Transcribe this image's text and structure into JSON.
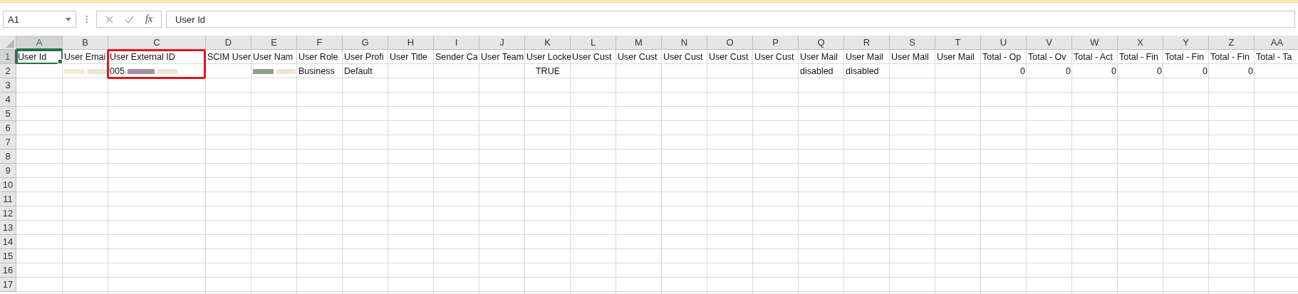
{
  "name_box": {
    "value": "A1"
  },
  "formula_bar": {
    "function_label": "fx",
    "value": "User Id"
  },
  "columns": [
    {
      "letter": "A",
      "selected": true,
      "highlighted": false
    },
    {
      "letter": "B",
      "selected": false,
      "highlighted": false
    },
    {
      "letter": "C",
      "selected": false,
      "highlighted": true
    },
    {
      "letter": "D",
      "selected": false,
      "highlighted": false
    },
    {
      "letter": "E",
      "selected": false,
      "highlighted": false
    },
    {
      "letter": "F",
      "selected": false,
      "highlighted": false
    },
    {
      "letter": "G",
      "selected": false,
      "highlighted": false
    },
    {
      "letter": "H",
      "selected": false,
      "highlighted": false
    },
    {
      "letter": "I",
      "selected": false,
      "highlighted": false
    },
    {
      "letter": "J",
      "selected": false,
      "highlighted": false
    },
    {
      "letter": "K",
      "selected": false,
      "highlighted": false
    },
    {
      "letter": "L",
      "selected": false,
      "highlighted": false
    },
    {
      "letter": "M",
      "selected": false,
      "highlighted": false
    },
    {
      "letter": "N",
      "selected": false,
      "highlighted": false
    },
    {
      "letter": "O",
      "selected": false,
      "highlighted": false
    },
    {
      "letter": "P",
      "selected": false,
      "highlighted": false
    },
    {
      "letter": "Q",
      "selected": false,
      "highlighted": false
    },
    {
      "letter": "R",
      "selected": false,
      "highlighted": false
    },
    {
      "letter": "S",
      "selected": false,
      "highlighted": false
    },
    {
      "letter": "T",
      "selected": false,
      "highlighted": false
    },
    {
      "letter": "U",
      "selected": false,
      "highlighted": false
    },
    {
      "letter": "V",
      "selected": false,
      "highlighted": false
    },
    {
      "letter": "W",
      "selected": false,
      "highlighted": false
    },
    {
      "letter": "X",
      "selected": false,
      "highlighted": false
    },
    {
      "letter": "Y",
      "selected": false,
      "highlighted": false
    },
    {
      "letter": "Z",
      "selected": false,
      "highlighted": false
    },
    {
      "letter": "AA",
      "selected": false,
      "highlighted": false
    }
  ],
  "rows": [
    {
      "number": "1",
      "selected": true,
      "cells": [
        {
          "kind": "text",
          "text": "User Id",
          "selected": true
        },
        {
          "kind": "text",
          "text": "User Emai",
          "selected": false
        },
        {
          "kind": "text",
          "text": "User External ID",
          "selected": false
        },
        {
          "kind": "text",
          "text": "SCIM User",
          "selected": false
        },
        {
          "kind": "text",
          "text": "User Nam",
          "selected": false
        },
        {
          "kind": "text",
          "text": "User Role",
          "selected": false
        },
        {
          "kind": "text",
          "text": "User Profi",
          "selected": false
        },
        {
          "kind": "text",
          "text": "User Title",
          "selected": false
        },
        {
          "kind": "text",
          "text": "Sender Ca",
          "selected": false
        },
        {
          "kind": "text",
          "text": "User Team",
          "selected": false
        },
        {
          "kind": "text",
          "text": "User Locke",
          "selected": false
        },
        {
          "kind": "text",
          "text": "User Cust",
          "selected": false
        },
        {
          "kind": "text",
          "text": "User Cust",
          "selected": false
        },
        {
          "kind": "text",
          "text": "User Cust",
          "selected": false
        },
        {
          "kind": "text",
          "text": "User Cust",
          "selected": false
        },
        {
          "kind": "text",
          "text": "User Cust",
          "selected": false
        },
        {
          "kind": "text",
          "text": "User Mail",
          "selected": false
        },
        {
          "kind": "text",
          "text": "User Mail",
          "selected": false
        },
        {
          "kind": "text",
          "text": "User Mail",
          "selected": false
        },
        {
          "kind": "text",
          "text": "User Mail",
          "selected": false
        },
        {
          "kind": "text",
          "text": "Total - Op",
          "selected": false
        },
        {
          "kind": "text",
          "text": "Total - Ov",
          "selected": false
        },
        {
          "kind": "text",
          "text": "Total - Act",
          "selected": false
        },
        {
          "kind": "text",
          "text": "Total - Fin",
          "selected": false
        },
        {
          "kind": "text",
          "text": "Total - Fin",
          "selected": false
        },
        {
          "kind": "text",
          "text": "Total - Fin",
          "selected": false
        },
        {
          "kind": "text",
          "text": "Total - Ta",
          "selected": false
        }
      ]
    },
    {
      "number": "2",
      "selected": false,
      "cells": [
        {
          "kind": "blank"
        },
        {
          "kind": "redacted",
          "selected": false
        },
        {
          "kind": "redacted",
          "text": "005",
          "selected": false
        },
        {
          "kind": "blank"
        },
        {
          "kind": "redacted",
          "selected": false
        },
        {
          "kind": "text",
          "text": "Business",
          "selected": false
        },
        {
          "kind": "text",
          "text": "Default",
          "selected": false
        },
        {
          "kind": "blank"
        },
        {
          "kind": "blank"
        },
        {
          "kind": "blank"
        },
        {
          "kind": "boolean",
          "text": "TRUE",
          "selected": false
        },
        {
          "kind": "blank"
        },
        {
          "kind": "blank"
        },
        {
          "kind": "blank"
        },
        {
          "kind": "blank"
        },
        {
          "kind": "blank"
        },
        {
          "kind": "text",
          "text": "disabled",
          "selected": false
        },
        {
          "kind": "text",
          "text": "disabled",
          "selected": false
        },
        {
          "kind": "blank"
        },
        {
          "kind": "blank"
        },
        {
          "kind": "number",
          "text": "0",
          "selected": false
        },
        {
          "kind": "number",
          "text": "0",
          "selected": false
        },
        {
          "kind": "number",
          "text": "0",
          "selected": false
        },
        {
          "kind": "number",
          "text": "0",
          "selected": false
        },
        {
          "kind": "number",
          "text": "0",
          "selected": false
        },
        {
          "kind": "number",
          "text": "0",
          "selected": false
        },
        {
          "kind": "blank"
        }
      ]
    },
    {
      "number": "3",
      "selected": false
    },
    {
      "number": "4",
      "selected": false
    },
    {
      "number": "5",
      "selected": false
    },
    {
      "number": "6",
      "selected": false
    },
    {
      "number": "7",
      "selected": false
    },
    {
      "number": "8",
      "selected": false
    },
    {
      "number": "9",
      "selected": false
    },
    {
      "number": "10",
      "selected": false
    },
    {
      "number": "11",
      "selected": false
    },
    {
      "number": "12",
      "selected": false
    },
    {
      "number": "13",
      "selected": false
    },
    {
      "number": "14",
      "selected": false
    },
    {
      "number": "15",
      "selected": false
    },
    {
      "number": "16",
      "selected": false
    },
    {
      "number": "17",
      "selected": false
    }
  ]
}
